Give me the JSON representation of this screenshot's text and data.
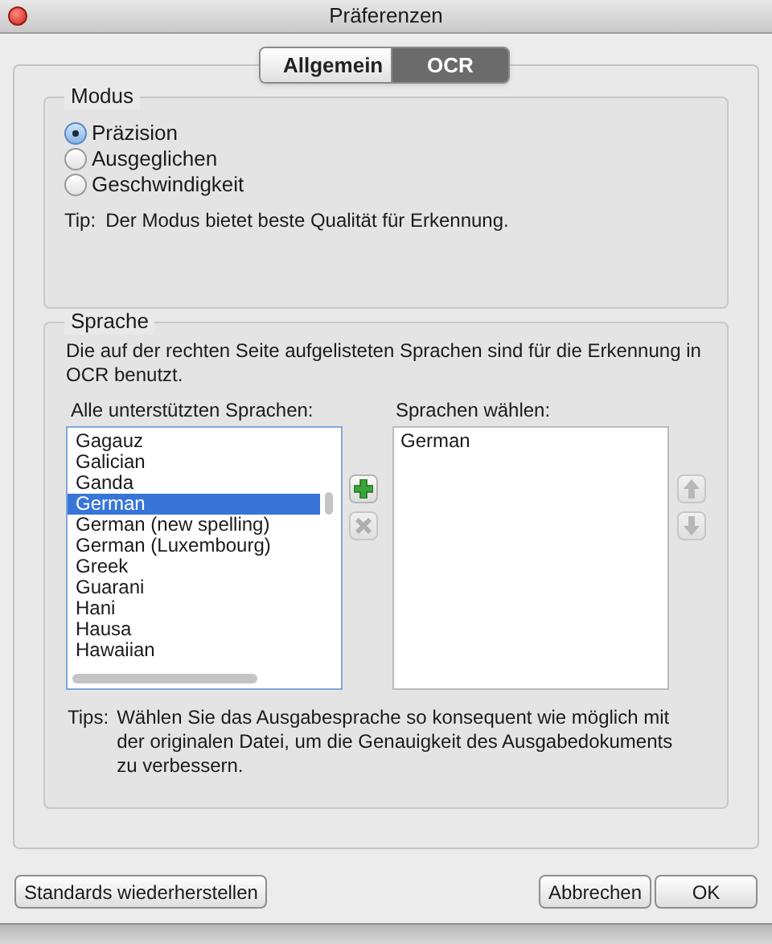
{
  "window": {
    "title": "Präferenzen"
  },
  "tabs": [
    {
      "label": "Allgemein",
      "selected": false
    },
    {
      "label": "OCR",
      "selected": true
    }
  ],
  "mode_group": {
    "title": "Modus",
    "options": [
      {
        "label": "Präzision",
        "selected": true
      },
      {
        "label": "Ausgeglichen",
        "selected": false
      },
      {
        "label": "Geschwindigkeit",
        "selected": false
      }
    ],
    "tip_label": "Tip:",
    "tip": "Der Modus bietet beste Qualität für Erkennung."
  },
  "language_group": {
    "title": "Sprache",
    "description": "Die auf der rechten Seite aufgelisteten Sprachen sind für die Erkennung in OCR benutzt.",
    "all_label": "Alle unterstützten Sprachen:",
    "all_languages": [
      {
        "label": "Gagauz",
        "selected": false
      },
      {
        "label": "Galician",
        "selected": false
      },
      {
        "label": "Ganda",
        "selected": false
      },
      {
        "label": "German",
        "selected": true
      },
      {
        "label": "German (new spelling)",
        "selected": false
      },
      {
        "label": "German (Luxembourg)",
        "selected": false
      },
      {
        "label": "Greek",
        "selected": false
      },
      {
        "label": "Guarani",
        "selected": false
      },
      {
        "label": "Hani",
        "selected": false
      },
      {
        "label": "Hausa",
        "selected": false
      },
      {
        "label": "Hawaiian",
        "selected": false
      }
    ],
    "chosen_label": "Sprachen wählen:",
    "chosen_languages": [
      "German"
    ],
    "tips_label": "Tips:",
    "tips": "Wählen Sie das Ausgabesprache so konsequent wie möglich mit der originalen Datei, um die Genauigkeit des Ausgabedokuments zu verbessern."
  },
  "buttons": {
    "reset": "Standards wiederherstellen",
    "cancel": "Abbrechen",
    "ok": "OK"
  }
}
